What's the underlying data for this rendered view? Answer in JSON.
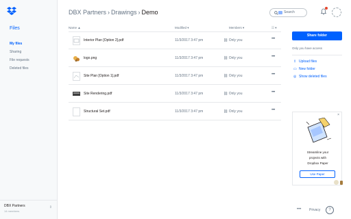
{
  "sidebar": {
    "title": "Files",
    "items": [
      {
        "label": "My files",
        "active": true
      },
      {
        "label": "Sharing",
        "active": false
      },
      {
        "label": "File requests",
        "active": false
      },
      {
        "label": "Deleted files",
        "active": false
      }
    ],
    "team": {
      "name": "DBX Partners",
      "members": "14 members"
    }
  },
  "header": {
    "breadcrumb": [
      "DBX Partners",
      "Drawings",
      "Demo"
    ],
    "search_placeholder": "Search"
  },
  "table": {
    "columns": {
      "name": "Name ▲",
      "modified": "Modified ▾",
      "members": "Members ▾",
      "view": "☷ ▾"
    },
    "rows": [
      {
        "name": "Interior Plan [Option 2].pdf",
        "modified": "11/3/2017 3:47 pm",
        "members": "Only you",
        "thumb": "pdf-plan"
      },
      {
        "name": "logo.png",
        "modified": "11/3/2017 3:47 pm",
        "members": "Only you",
        "thumb": "image"
      },
      {
        "name": "Site Plan [Option 1].pdf",
        "modified": "11/3/2017 3:47 pm",
        "members": "Only you",
        "thumb": "pdf-site"
      },
      {
        "name": "Site Rendering.pdf",
        "modified": "11/3/2017 3:47 pm",
        "members": "Only you",
        "thumb": "pdf-render"
      },
      {
        "name": "Structural Set.pdf",
        "modified": "11/3/2017 3:47 pm",
        "members": "Only you",
        "thumb": "pdf-blank"
      }
    ],
    "more_label": "•••"
  },
  "rail": {
    "share_label": "Share folder",
    "access_text": "Only you have access",
    "actions": [
      {
        "label": "Upload files",
        "icon": "upload-icon"
      },
      {
        "label": "New folder",
        "icon": "new-folder-icon"
      },
      {
        "label": "Show deleted files",
        "icon": "show-deleted-icon"
      }
    ]
  },
  "promo": {
    "close": "×",
    "text_lines": [
      "Streamline your",
      "projects with",
      "Dropbox Paper"
    ],
    "button": "Use Paper"
  },
  "footer": {
    "more": "•••",
    "privacy": "Privacy",
    "help": "?"
  },
  "colors": {
    "accent": "#0061fe",
    "text": "#1e1919",
    "muted": "#637282"
  }
}
